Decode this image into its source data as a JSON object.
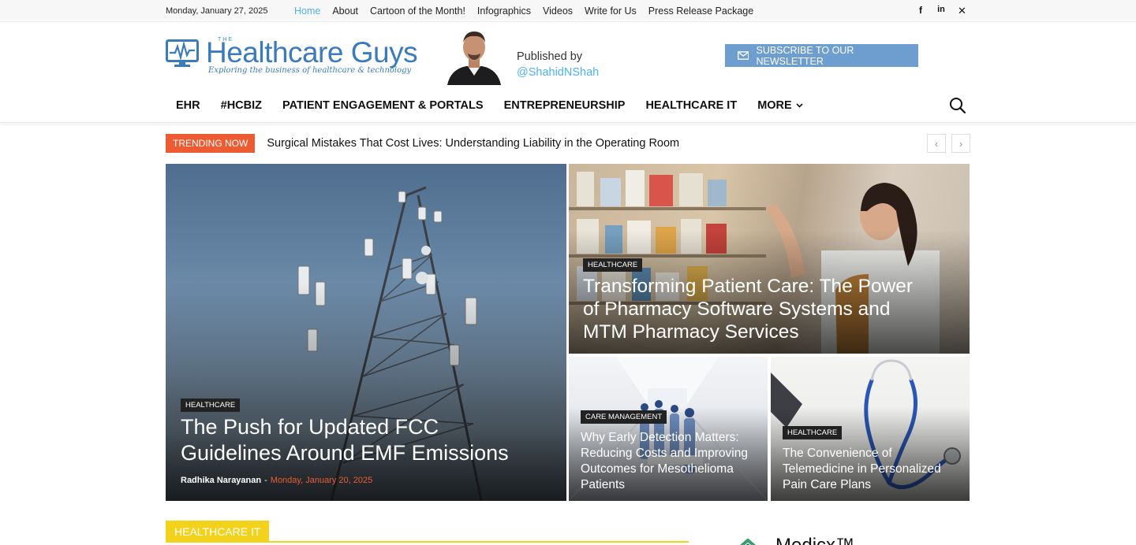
{
  "topbar": {
    "date": "Monday, January 27, 2025",
    "nav": [
      "Home",
      "About",
      "Cartoon of the Month!",
      "Infographics",
      "Videos",
      "Write for Us",
      "Press Release Package"
    ],
    "social_icons": [
      "facebook-icon",
      "linkedin-icon",
      "x-twitter-icon"
    ]
  },
  "header": {
    "logo_small": "THE",
    "logo_name": "Healthcare Guys",
    "logo_tagline": "Exploring the business of healthcare & technology",
    "published_by": "Published by",
    "handle": "@ShahidNShah",
    "subscribe_label": "SUBSCRIBE TO OUR NEWSLETTER"
  },
  "mainnav": {
    "items": [
      "EHR",
      "#HCBIZ",
      "PATIENT ENGAGEMENT & PORTALS",
      "ENTREPRENEURSHIP",
      "HEALTHCARE IT",
      "MORE"
    ]
  },
  "trending": {
    "label": "TRENDING NOW",
    "title": "Surgical Mistakes That Cost Lives: Understanding Liability in the Operating Room"
  },
  "featured": [
    {
      "category": "HEALTHCARE",
      "title": "The Push for Updated FCC Guidelines Around EMF Emissions",
      "author": "Radhika Narayanan",
      "date": "Monday, January 20, 2025"
    },
    {
      "category": "HEALTHCARE",
      "title": "Transforming Patient Care: The Power of Pharmacy Software Systems and MTM Pharmacy Services"
    },
    {
      "category": "CARE MANAGEMENT",
      "title": "Why Early Detection Matters: Reducing Costs and Improving Outcomes for Mesothelioma Patients"
    },
    {
      "category": "HEALTHCARE",
      "title": "The Convenience of Telemedicine in Personalized Pain Care Plans"
    }
  ],
  "section": {
    "label": "HEALTHCARE IT"
  },
  "sidebar_ad": {
    "brand": "Medicx™"
  },
  "colors": {
    "accent": "#4db2ec",
    "trending": "#ed5b33",
    "section": "#f2d21a",
    "subscribe": "#6d9ecf",
    "logo": "#3a7bbd"
  }
}
